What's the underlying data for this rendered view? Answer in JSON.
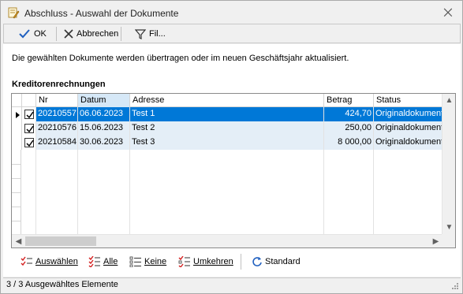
{
  "window": {
    "title": "Abschluss - Auswahl der Dokumente",
    "close_glyph": "⨉",
    "icon": "document-edit-icon"
  },
  "toolbar": {
    "ok_label": "OK",
    "cancel_label": "Abbrechen",
    "filter_label": "Fil..."
  },
  "info_text": "Die gewählten Dokumente werden übertragen oder im neuen Geschäftsjahr aktualisiert.",
  "section_title": "Kreditorenrechnungen",
  "grid": {
    "columns": [
      "Nr",
      "Datum",
      "Adresse",
      "Betrag",
      "Status"
    ],
    "sorted_column": "Datum",
    "rows": [
      {
        "checked": true,
        "nr": "20210557",
        "datum": "06.06.2023",
        "adresse": "Test 1",
        "betrag": "424,70",
        "status": "Originaldokument",
        "selected": true
      },
      {
        "checked": true,
        "nr": "20210576",
        "datum": "15.06.2023",
        "adresse": "Test 2",
        "betrag": "250,00",
        "status": "Originaldokument",
        "selected": false
      },
      {
        "checked": true,
        "nr": "20210584",
        "datum": "30.06.2023",
        "adresse": "Test 3",
        "betrag": "8 000,00",
        "status": "Originaldokument",
        "selected": false
      }
    ]
  },
  "actions": {
    "select_all_label": "Auswählen",
    "all_label": "Alle",
    "none_label": "Keine",
    "invert_label": "Umkehren",
    "default_label": "Standard"
  },
  "status": "3 / 3 Ausgewähltes Elemente",
  "colors": {
    "selection": "#0078d7",
    "alt_row": "#e4eef7",
    "accent_red": "#d42020"
  }
}
